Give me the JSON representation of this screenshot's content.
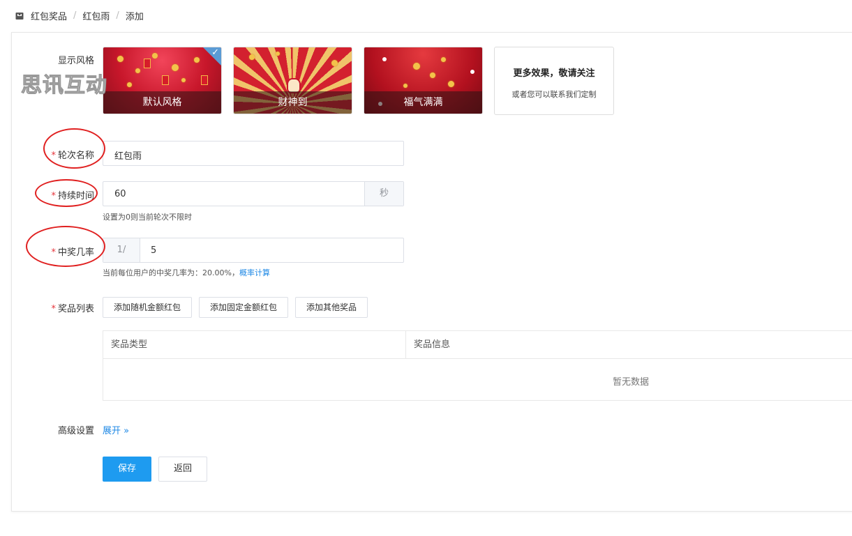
{
  "breadcrumb": {
    "items": [
      "红包奖品",
      "红包雨",
      "添加"
    ],
    "separator": "/"
  },
  "form": {
    "style_label": "显示风格",
    "styles": [
      {
        "caption": "默认风格",
        "selected": true
      },
      {
        "caption": "财神到",
        "selected": false
      },
      {
        "caption": "福气满满",
        "selected": false
      }
    ],
    "more_title": "更多效果，敬请关注",
    "more_sub": "或者您可以联系我们定制",
    "watermark": "思讯互动",
    "round_name_label": "轮次名称",
    "round_name_value": "红包雨",
    "duration_label": "持续时间",
    "duration_value": "60",
    "duration_unit": "秒",
    "duration_hint": "设置为0则当前轮次不限时",
    "rate_label": "中奖几率",
    "rate_prefix": "1/",
    "rate_value": "5",
    "rate_hint": "当前每位用户的中奖几率为：20.00%，",
    "rate_link": "概率计算",
    "prize_label": "奖品列表",
    "prize_buttons": [
      "添加随机金额红包",
      "添加固定金额红包",
      "添加其他奖品"
    ],
    "table_headers": [
      "奖品类型",
      "奖品信息"
    ],
    "table_empty": "暂无数据",
    "advanced_label": "高级设置",
    "advanced_toggle": "展开 »",
    "save": "保存",
    "back": "返回"
  },
  "colors": {
    "accent": "#1e9bf0",
    "required": "#e5343b",
    "annotation": "#e02020"
  }
}
